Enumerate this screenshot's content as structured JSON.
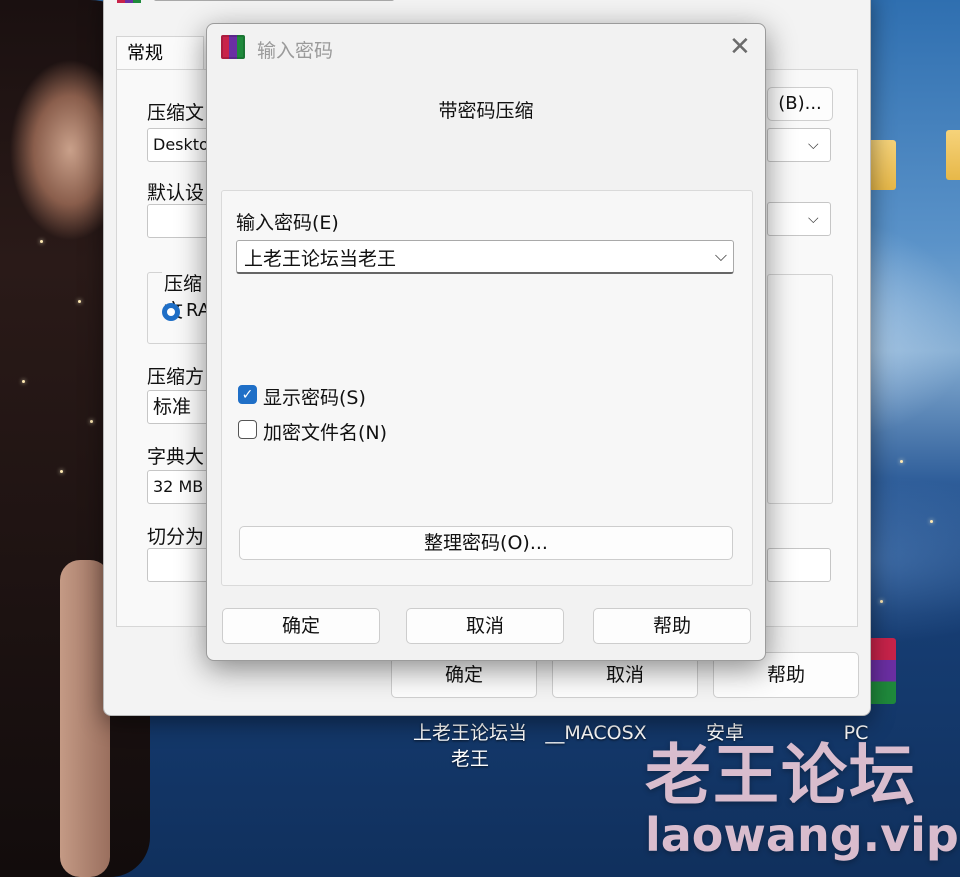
{
  "desktop": {
    "labels": {
      "folder_1_line1": "上老王论坛当",
      "folder_1_line2": "老王",
      "folder_2": "__MACOSX",
      "folder_3": "安卓",
      "folder_4": "PC"
    },
    "watermark": {
      "cn": "老王论坛",
      "en": "laowang.vip"
    }
  },
  "archive_window": {
    "tab_general": "常规",
    "browse_button": "(B)...",
    "archive_name_label": "压缩文",
    "archive_name_value": "Deskto",
    "default_profile_label": "默认设",
    "format_group_label": "压缩文",
    "format_radio_label": "RA",
    "method_label": "压缩方",
    "method_value": "标准",
    "dict_label": "字典大",
    "dict_value": "32 MB",
    "split_label": "切分为",
    "ok_button": "确定",
    "cancel_button": "取消",
    "help_button": "帮助"
  },
  "password_dialog": {
    "title": "输入密码",
    "heading": "带密码压缩",
    "password_label": "输入密码(E)",
    "password_value": "上老王论坛当老王",
    "show_password_label": "显示密码(S)",
    "show_password_checked": true,
    "encrypt_names_label": "加密文件名(N)",
    "encrypt_names_checked": false,
    "organize_button": "整理密码(O)...",
    "ok_button": "确定",
    "cancel_button": "取消",
    "help_button": "帮助"
  },
  "colors": {
    "accent": "#1f6fc7",
    "dialog_bg": "#f2f2f2",
    "watermark": "#f0cddc"
  }
}
